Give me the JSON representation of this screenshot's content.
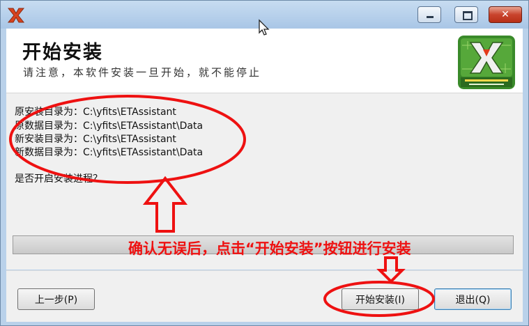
{
  "window": {
    "min_icon": "minimize-icon",
    "max_icon": "maximize-icon",
    "close_icon": "close-icon",
    "close_glyph": "✕"
  },
  "header": {
    "title": "开始安装",
    "subtitle": "请注意，本软件安装一旦开始，就不能停止",
    "logo_lettering": "永锋信息技术工作室 www.yfits.com"
  },
  "content": {
    "lines": [
      "原安装目录为：C:\\yfits\\ETAssistant",
      "原数据目录为：C:\\yfits\\ETAssistant\\Data",
      "新安装目录为：C:\\yfits\\ETAssistant",
      "新数据目录为：C:\\yfits\\ETAssistant\\Data"
    ],
    "prompt": "是否开启安装进程？",
    "progress_fraction": 0
  },
  "annotation": {
    "note": "确认无误后，点击“开始安装”按钮进行安装",
    "color": "#ee1111"
  },
  "footer": {
    "prev_label": "上一步(P)",
    "start_label": "开始安装(I)",
    "exit_label": "退出(Q)"
  }
}
